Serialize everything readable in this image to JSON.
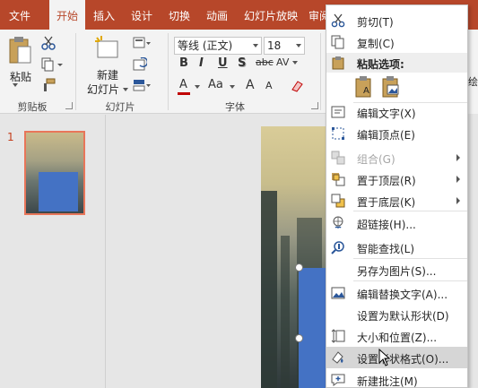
{
  "tabs": [
    "文件",
    "开始",
    "插入",
    "设计",
    "切换",
    "动画",
    "幻灯片放映",
    "审阅"
  ],
  "active_tab": "开始",
  "ribbon": {
    "clipboard": {
      "paste_label": "粘贴",
      "group_label": "剪贴板"
    },
    "slides": {
      "new_slide_line1": "新建",
      "new_slide_line2": "幻灯片",
      "group_label": "幻灯片"
    },
    "font": {
      "font_name": "等线 (正文)",
      "font_size": "18",
      "group_label": "字体",
      "bold": "B",
      "italic": "I",
      "underline": "U",
      "shadow": "S",
      "strike": "abc",
      "spacing": "AV",
      "color_a": "A",
      "case": "Aa",
      "grow": "A",
      "shrink": "A"
    },
    "right_sliver": "绘"
  },
  "thumbnail": {
    "number": "1"
  },
  "context_menu": {
    "items": [
      {
        "label": "剪切(T)",
        "icon": "scissors-icon"
      },
      {
        "label": "复制(C)",
        "icon": "copy-icon"
      },
      {
        "label": "粘贴选项:",
        "icon": "paste-icon"
      },
      {
        "label": "编辑文字(X)",
        "icon": "edit-text-icon"
      },
      {
        "label": "编辑顶点(E)",
        "icon": "edit-points-icon"
      },
      {
        "label": "组合(G)",
        "icon": "group-icon"
      },
      {
        "label": "置于顶层(R)",
        "icon": "bring-front-icon"
      },
      {
        "label": "置于底层(K)",
        "icon": "send-back-icon"
      },
      {
        "label": "超链接(H)...",
        "icon": "hyperlink-icon"
      },
      {
        "label": "智能查找(L)",
        "icon": "smart-lookup-icon"
      },
      {
        "label": "另存为图片(S)...",
        "icon": ""
      },
      {
        "label": "编辑替换文字(A)...",
        "icon": "alt-text-icon"
      },
      {
        "label": "设置为默认形状(D)",
        "icon": ""
      },
      {
        "label": "大小和位置(Z)...",
        "icon": "size-position-icon"
      },
      {
        "label": "设置形状格式(O)...",
        "icon": "format-shape-icon"
      },
      {
        "label": "新建批注(M)",
        "icon": "new-comment-icon"
      }
    ]
  },
  "colors": {
    "accent": "#b7472a",
    "font_color": "#c00000",
    "highlight": "#4472c4"
  }
}
